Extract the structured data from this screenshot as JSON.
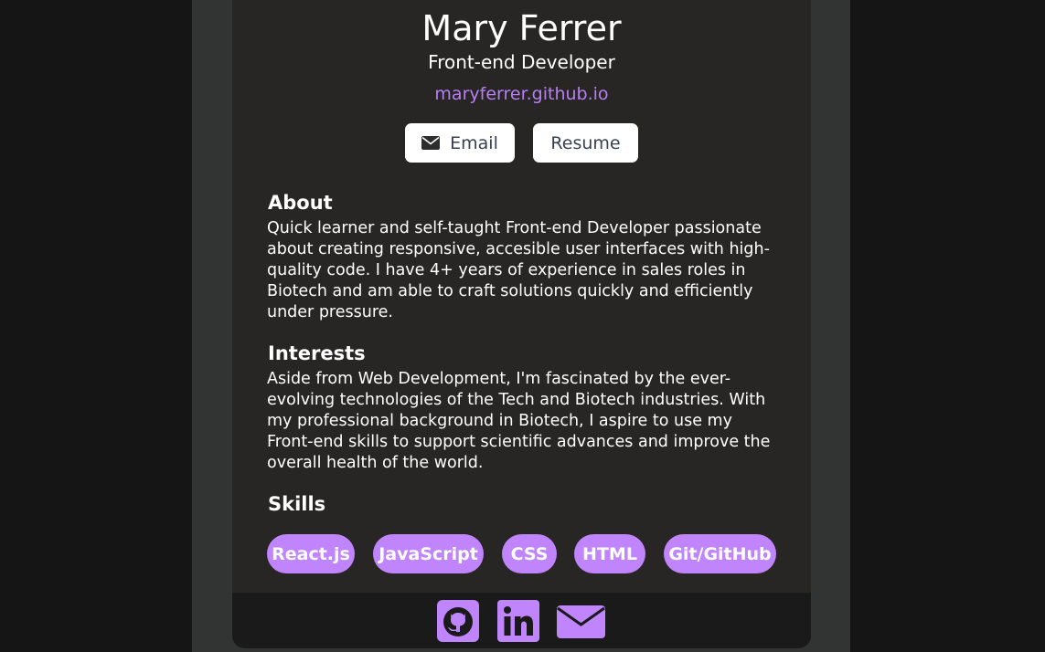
{
  "profile": {
    "name": "Mary Ferrer",
    "title": "Front-end Developer",
    "website": "maryferrer.github.io"
  },
  "actions": {
    "email_label": "Email",
    "resume_label": "Resume"
  },
  "about": {
    "heading": "About",
    "text": "Quick learner and self-taught Front-end Developer passionate about creating responsive, accesible user interfaces with high-quality code. I have 4+ years of experience in sales roles in Biotech and am able to craft solutions quickly and efficiently under pressure."
  },
  "interests": {
    "heading": "Interests",
    "text": "Aside from Web Development, I'm fascinated by the ever-evolving technologies of the Tech and Biotech industries. With my professional background in Biotech, I aspire to use my Front-end skills to support scientific advances and improve the overall health of the world."
  },
  "skills": {
    "heading": "Skills",
    "items": [
      "React.js",
      "JavaScript",
      "CSS",
      "HTML",
      "Git/GitHub"
    ]
  },
  "footer": {
    "icons": [
      "github-icon",
      "linkedin-icon",
      "email-icon"
    ]
  },
  "colors": {
    "accent": "#c084fc",
    "link": "#b77ff3",
    "card_bg": "#282625",
    "footer_bg": "#1a1a1a"
  }
}
